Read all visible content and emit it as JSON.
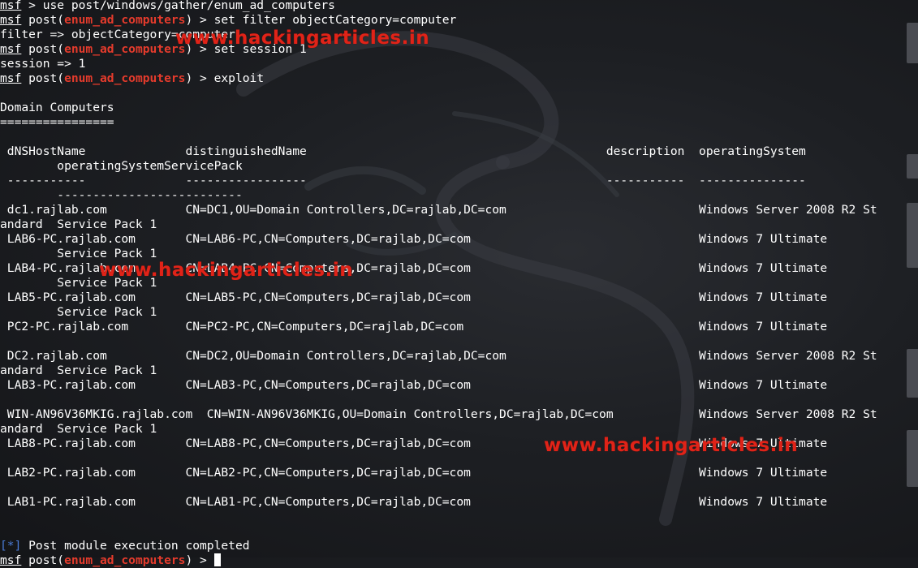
{
  "terminal": {
    "lines": [
      [
        {
          "t": "msf",
          "c": "msf"
        },
        {
          "t": " > use post/windows/gather/enum_ad_computers"
        }
      ],
      [
        {
          "t": "msf",
          "c": "msf"
        },
        {
          "t": " post("
        },
        {
          "t": "enum_ad_computers",
          "c": "mod"
        },
        {
          "t": ") > set filter objectCategory=computer"
        }
      ],
      [
        {
          "t": "filter => objectCategory=computer"
        }
      ],
      [
        {
          "t": "msf",
          "c": "msf"
        },
        {
          "t": " post("
        },
        {
          "t": "enum_ad_computers",
          "c": "mod"
        },
        {
          "t": ") > set session 1"
        }
      ],
      [
        {
          "t": "session => 1"
        }
      ],
      [
        {
          "t": "msf",
          "c": "msf"
        },
        {
          "t": " post("
        },
        {
          "t": "enum_ad_computers",
          "c": "mod"
        },
        {
          "t": ") > exploit"
        }
      ],
      [
        {
          "t": ""
        }
      ],
      [
        {
          "t": "Domain Computers"
        }
      ],
      [
        {
          "t": "================"
        }
      ],
      [
        {
          "t": ""
        }
      ],
      [
        {
          "t": " dNSHostName              distinguishedName                                          description  operatingSystem"
        }
      ],
      [
        {
          "t": "        operatingSystemServicePack"
        }
      ],
      [
        {
          "t": " -----------              -----------------                                          -----------  ---------------"
        }
      ],
      [
        {
          "t": "        --------------------------"
        }
      ],
      [
        {
          "t": " dc1.rajlab.com           CN=DC1,OU=Domain Controllers,DC=rajlab,DC=com                           Windows Server 2008 R2 St"
        }
      ],
      [
        {
          "t": "andard  Service Pack 1"
        }
      ],
      [
        {
          "t": " LAB6-PC.rajlab.com       CN=LAB6-PC,CN=Computers,DC=rajlab,DC=com                                Windows 7 Ultimate"
        }
      ],
      [
        {
          "t": "        Service Pack 1"
        }
      ],
      [
        {
          "t": " LAB4-PC.rajlab.com       CN=LAB4-PC,CN=Computers,DC=rajlab,DC=com                                Windows 7 Ultimate"
        }
      ],
      [
        {
          "t": "        Service Pack 1"
        }
      ],
      [
        {
          "t": " LAB5-PC.rajlab.com       CN=LAB5-PC,CN=Computers,DC=rajlab,DC=com                                Windows 7 Ultimate"
        }
      ],
      [
        {
          "t": "        Service Pack 1"
        }
      ],
      [
        {
          "t": " PC2-PC.rajlab.com        CN=PC2-PC,CN=Computers,DC=rajlab,DC=com                                 Windows 7 Ultimate"
        }
      ],
      [
        {
          "t": ""
        }
      ],
      [
        {
          "t": " DC2.rajlab.com           CN=DC2,OU=Domain Controllers,DC=rajlab,DC=com                           Windows Server 2008 R2 St"
        }
      ],
      [
        {
          "t": "andard  Service Pack 1"
        }
      ],
      [
        {
          "t": " LAB3-PC.rajlab.com       CN=LAB3-PC,CN=Computers,DC=rajlab,DC=com                                Windows 7 Ultimate"
        }
      ],
      [
        {
          "t": ""
        }
      ],
      [
        {
          "t": " WIN-AN96V36MKIG.rajlab.com  CN=WIN-AN96V36MKIG,OU=Domain Controllers,DC=rajlab,DC=com            Windows Server 2008 R2 St"
        }
      ],
      [
        {
          "t": "andard  Service Pack 1"
        }
      ],
      [
        {
          "t": " LAB8-PC.rajlab.com       CN=LAB8-PC,CN=Computers,DC=rajlab,DC=com                                Windows 7 Ultimate"
        }
      ],
      [
        {
          "t": ""
        }
      ],
      [
        {
          "t": " LAB2-PC.rajlab.com       CN=LAB2-PC,CN=Computers,DC=rajlab,DC=com                                Windows 7 Ultimate"
        }
      ],
      [
        {
          "t": ""
        }
      ],
      [
        {
          "t": " LAB1-PC.rajlab.com       CN=LAB1-PC,CN=Computers,DC=rajlab,DC=com                                Windows 7 Ultimate"
        }
      ],
      [
        {
          "t": ""
        }
      ],
      [
        {
          "t": ""
        }
      ],
      [
        {
          "t": "[*]",
          "c": "status"
        },
        {
          "t": " Post module execution completed"
        }
      ],
      [
        {
          "t": "msf",
          "c": "msf"
        },
        {
          "t": " post("
        },
        {
          "t": "enum_ad_computers",
          "c": "mod"
        },
        {
          "t": ") > "
        },
        {
          "t": "",
          "c": "cursor"
        }
      ]
    ]
  },
  "watermark": {
    "text": "www.hackingarticles.in"
  },
  "colors": {
    "background": "#1d1f23",
    "text": "#ffffff",
    "module": "#e53b2c",
    "status": "#4a7bd6",
    "watermark": "#e02318"
  },
  "icons": {
    "background_art": "kali-dragon-logo"
  }
}
